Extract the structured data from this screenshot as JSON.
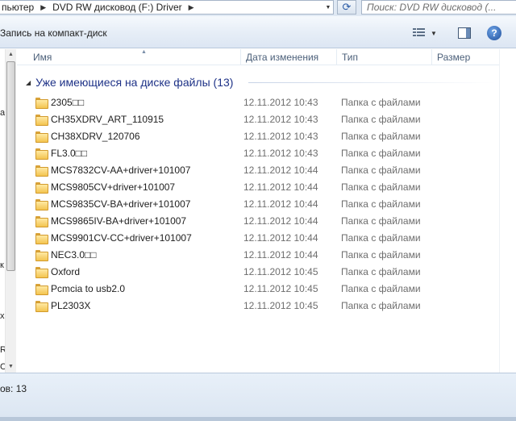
{
  "address": {
    "crumbs": [
      "пьютер",
      "DVD RW дисковод (F:) Driver"
    ],
    "search_placeholder": "Поиск: DVD RW дисковод (..."
  },
  "toolbar": {
    "burn_label": "Запись на компакт-диск",
    "help_label": "?"
  },
  "left_nav": {
    "fragments": [
      "а",
      "к",
      "х",
      "R",
      "С"
    ]
  },
  "columns": {
    "name": "Имя",
    "date": "Дата изменения",
    "type": "Тип",
    "size": "Размер"
  },
  "group": {
    "title": "Уже имеющиеся на диске файлы (13)"
  },
  "files": [
    {
      "name": "2305□□",
      "date": "12.11.2012 10:43",
      "type": "Папка с файлами"
    },
    {
      "name": "CH35XDRV_ART_110915",
      "date": "12.11.2012 10:43",
      "type": "Папка с файлами"
    },
    {
      "name": "CH38XDRV_120706",
      "date": "12.11.2012 10:43",
      "type": "Папка с файлами"
    },
    {
      "name": "FL3.0□□",
      "date": "12.11.2012 10:43",
      "type": "Папка с файлами"
    },
    {
      "name": "MCS7832CV-AA+driver+101007",
      "date": "12.11.2012 10:44",
      "type": "Папка с файлами"
    },
    {
      "name": "MCS9805CV+driver+101007",
      "date": "12.11.2012 10:44",
      "type": "Папка с файлами"
    },
    {
      "name": "MCS9835CV-BA+driver+101007",
      "date": "12.11.2012 10:44",
      "type": "Папка с файлами"
    },
    {
      "name": "MCS9865IV-BA+driver+101007",
      "date": "12.11.2012 10:44",
      "type": "Папка с файлами"
    },
    {
      "name": "MCS9901CV-CC+driver+101007",
      "date": "12.11.2012 10:44",
      "type": "Папка с файлами"
    },
    {
      "name": "NEC3.0□□",
      "date": "12.11.2012 10:44",
      "type": "Папка с файлами"
    },
    {
      "name": "Oxford",
      "date": "12.11.2012 10:45",
      "type": "Папка с файлами"
    },
    {
      "name": "Pcmcia to usb2.0",
      "date": "12.11.2012 10:45",
      "type": "Папка с файлами"
    },
    {
      "name": "PL2303X",
      "date": "12.11.2012 10:45",
      "type": "Папка с файлами"
    }
  ],
  "details": {
    "count_text": "ов: 13"
  }
}
